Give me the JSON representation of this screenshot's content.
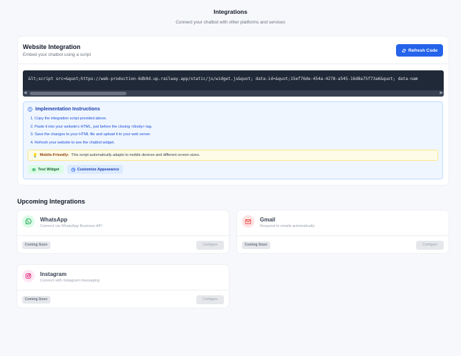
{
  "header": {
    "title": "Integrations",
    "subtitle": "Connect your chatbot with other platforms and services"
  },
  "website": {
    "title": "Website Integration",
    "description": "Embed your chatbot using a script",
    "refresh_label": "Refresh Code",
    "code": "&lt;script src=&quot;https://web-production-6db9d.up.railway.app/static/js/widget.js&quot; data-id=&quot;15ef76de-454a-4278-a545-16d8a75f73a6&quot; data-nam",
    "instructions_title": "Implementation Instructions",
    "steps": [
      "1. Copy the integration script provided above.",
      "2. Paste it into your website's HTML, just before the closing </body> tag.",
      "3. Save the changes to your HTML file and upload it to your web server.",
      "4. Refresh your website to see the chatbot widget."
    ],
    "tip_label": "Mobile-Friendly:",
    "tip_text": "This script automatically adapts to mobile devices and different screen sizes.",
    "test_label": "Test Widget",
    "customize_label": "Customize Appearance"
  },
  "upcoming": {
    "title": "Upcoming Integrations",
    "items": [
      {
        "name": "WhatsApp",
        "description": "Connect via WhatsApp Business API",
        "badge": "Coming Soon",
        "button": "Configure",
        "icon": "whatsapp-icon",
        "color": "#16a34a"
      },
      {
        "name": "Gmail",
        "description": "Respond to emails automatically",
        "badge": "Coming Soon",
        "button": "Configure",
        "icon": "mail-icon",
        "color": "#ef4444"
      },
      {
        "name": "Instagram",
        "description": "Connect with Instagram messaging",
        "badge": "Coming Soon",
        "button": "Configure",
        "icon": "instagram-icon",
        "color": "#db2777"
      }
    ]
  },
  "colors": {
    "accent": "#2563eb",
    "code_bg": "#1f2937"
  }
}
